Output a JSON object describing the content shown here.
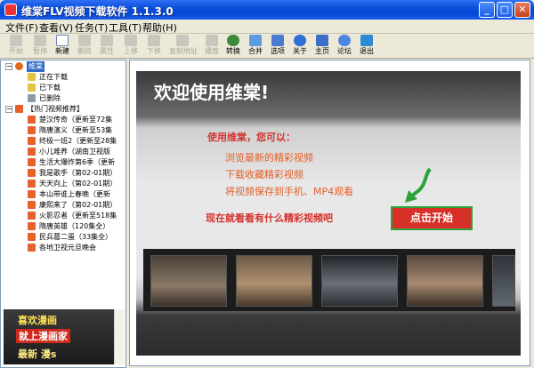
{
  "window": {
    "title": "维棠FLV视频下载软件 1.1.3.0",
    "minimize": "_",
    "maximize": "□",
    "close": "✕"
  },
  "menu": [
    {
      "label": "文件(F)"
    },
    {
      "label": "查看(V)"
    },
    {
      "label": "任务(T)"
    },
    {
      "label": "工具(T)"
    },
    {
      "label": "帮助(H)"
    }
  ],
  "toolbar": [
    {
      "label": "开始",
      "enabled": false
    },
    {
      "label": "暂停",
      "enabled": false
    },
    {
      "label": "新建",
      "enabled": true
    },
    {
      "label": "删除",
      "enabled": false
    },
    {
      "label": "属性",
      "enabled": false
    },
    {
      "label": "上移",
      "enabled": false
    },
    {
      "label": "下移",
      "enabled": false
    },
    {
      "label": "复制地址",
      "enabled": false
    },
    {
      "label": "播放",
      "enabled": false
    },
    {
      "label": "转换",
      "enabled": true
    },
    {
      "label": "合并",
      "enabled": true
    },
    {
      "label": "选项",
      "enabled": true
    },
    {
      "label": "关于",
      "enabled": true
    },
    {
      "label": "主页",
      "enabled": true
    },
    {
      "label": "论坛",
      "enabled": true
    },
    {
      "label": "退出",
      "enabled": true
    }
  ],
  "tree": {
    "root": "维棠",
    "folders": [
      "正在下载",
      "已下载",
      "已删除"
    ],
    "hot_group": "【热门视频推荐】",
    "hot_items": [
      "楚汉传奇（更新至72集",
      "隋唐演义（更新至53集",
      "终极一班2（更新至28集",
      "小儿难养（湖南卫视版",
      "生活大爆炸第6季（更新",
      "我是歌手（第02-01期）",
      "天天向上（第02-01期）",
      "本山带谁上春晚（更新",
      "康熙来了（第02-01期）",
      "火影忍者（更新至518集",
      "隋唐英雄（120集全）",
      "民兵葛二蛋（33集全）",
      "各地卫视元旦晚会"
    ]
  },
  "banner": {
    "line1": "喜欢漫画",
    "line2": "就上漫画家",
    "line3": "最新 漫s"
  },
  "main": {
    "welcome": "欢迎使用维棠!",
    "subhead": "使用维棠，您可以：",
    "features": [
      "浏览最新的精彩视频",
      "下载收藏精彩视频",
      "将视频保存到手机、MP4观看"
    ],
    "prompt": "现在就看看有什么精彩视频吧",
    "start_button": "点击开始"
  },
  "colors": {
    "accent_red": "#d63028",
    "feature_orange": "#e3602a",
    "title_blue": "#0a4fd8",
    "selection_blue": "#316ac5"
  }
}
